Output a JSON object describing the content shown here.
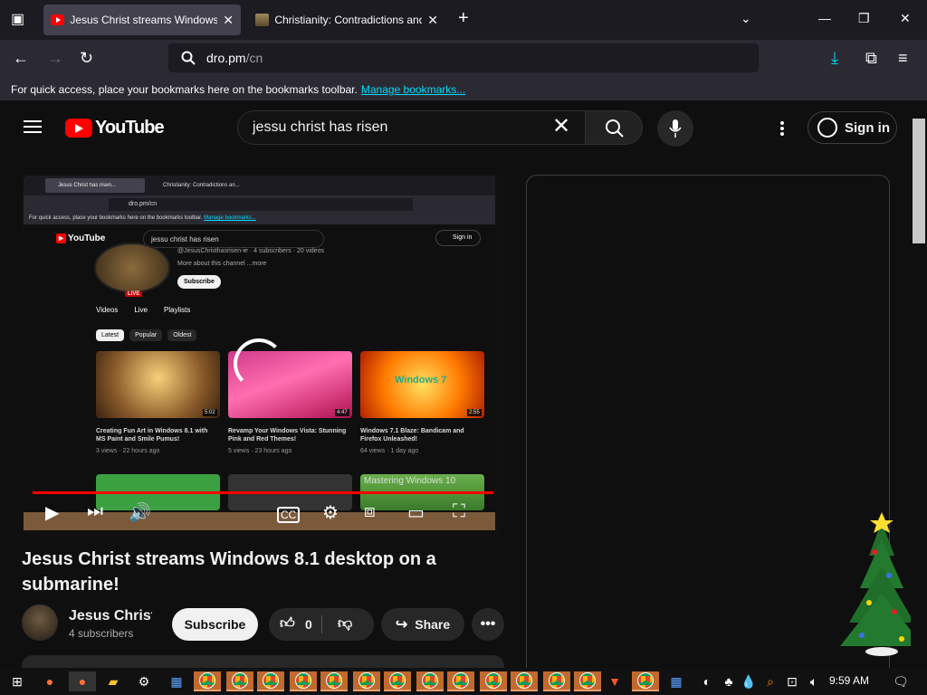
{
  "browser": {
    "tabs": [
      {
        "title": "Jesus Christ streams Windows 8.1 desktop on a submarine!"
      },
      {
        "title": "Christianity: Contradictions and..."
      }
    ],
    "url_host": "dro.pm",
    "url_path": "/cn",
    "bookmarks_text": "For quick access, place your bookmarks here on the bookmarks toolbar.",
    "bookmarks_link": "Manage bookmarks..."
  },
  "youtube": {
    "logo_text": "YouTube",
    "search_value": "jessu christ has risen",
    "sign_in": "Sign in"
  },
  "inner_capture": {
    "tab1": "Jesus Christ has risen...",
    "tab2": "Christianity: Contradictions an...",
    "url": "dro.pm/cn",
    "bookmarks": "For quick access, place your bookmarks here on the bookmarks toolbar.",
    "bookmarks_link": "Manage bookmarks...",
    "search": "jessu christ has risen",
    "channel": "@JesusChristhasrisen-ie",
    "channel_meta": "· 4 subscribers · 20 videos",
    "more": "More about this channel ...more",
    "subscribe": "Subscribe",
    "live": "LIVE",
    "tabs": [
      "Videos",
      "Live",
      "Playlists"
    ],
    "filters": [
      "Latest",
      "Popular",
      "Oldest"
    ],
    "videos": [
      {
        "title": "Creating Fun Art in Windows 8.1 with MS Paint and Smile Pumus!",
        "meta": "3 views · 22 hours ago",
        "duration": "5:02"
      },
      {
        "title": "Revamp Your Windows Vista: Stunning Pink and Red Themes!",
        "meta": "5 views · 23 hours ago",
        "duration": "4:47"
      },
      {
        "title": "Windows 7.1 Blaze: Bandicam and Firefox Unleashed!",
        "meta": "64 views · 1 day ago",
        "duration": "2:55"
      }
    ],
    "thumb3_text": "Windows 7",
    "row2_text": "Mastering Windows 10"
  },
  "video": {
    "title": "Jesus Christ streams Windows 8.1 desktop on a submarine!",
    "channel": "Jesus Christ has risen",
    "subscribers": "4 subscribers",
    "subscribe": "Subscribe",
    "likes": "0",
    "share": "Share",
    "progress": 1.0
  },
  "taskbar": {
    "clock": "9:59 AM"
  },
  "colors": {
    "accent_red": "#ff0000",
    "link": "#00ddff",
    "background": "#0f0f0f"
  }
}
